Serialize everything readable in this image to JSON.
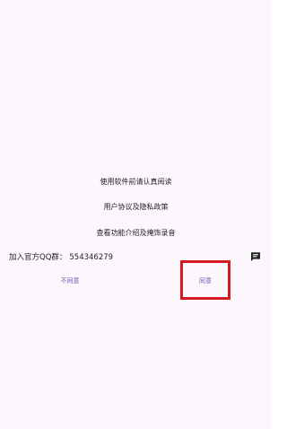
{
  "dialog": {
    "line1": "使用软件前请认真阅读",
    "line2": "用户协议及隐私政策",
    "line3": "查看功能介绍及掩饰录音",
    "qq_label": "加入官方QQ群：",
    "qq_number": "554346279",
    "disagree_label": "不同意",
    "agree_label": "同意"
  },
  "icons": {
    "message": "message-icon"
  },
  "colors": {
    "background": "#fcf7fd",
    "button_text": "#6b58b5",
    "highlight": "#d71920"
  }
}
